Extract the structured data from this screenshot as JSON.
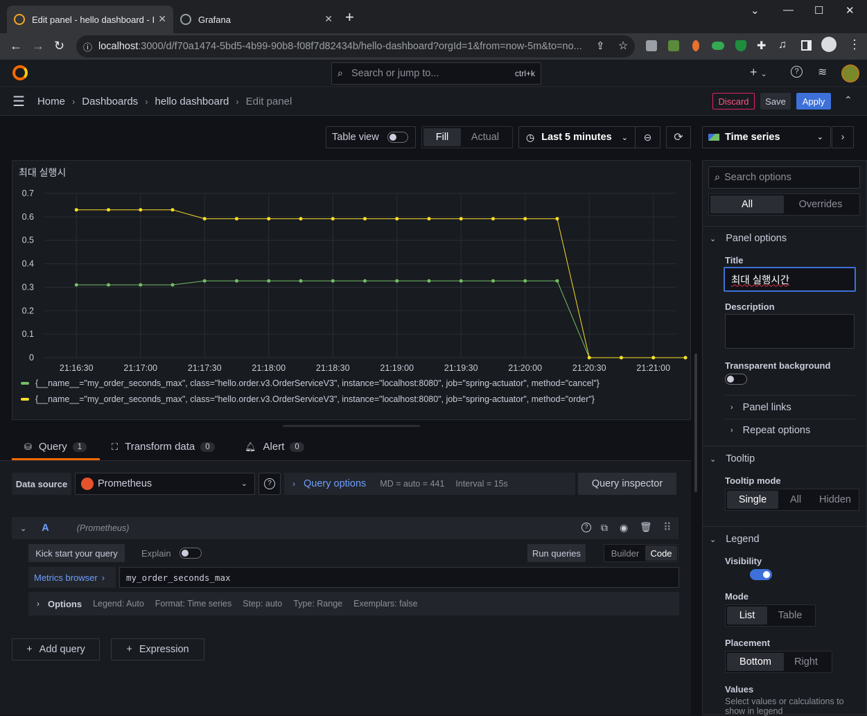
{
  "browser": {
    "tabs": [
      {
        "title": "Edit panel - hello dashboard - I"
      },
      {
        "title": "Grafana"
      }
    ],
    "url_host": "localhost",
    "url_path": ":3000/d/f70a1474-5bd5-4b99-90b8-f08f7d82434b/hello-dashboard?orgId=1&from=now-5m&to=no..."
  },
  "header": {
    "search_placeholder": "Search or jump to...",
    "search_shortcut": "ctrl+k",
    "add_label": "+"
  },
  "breadcrumbs": [
    "Home",
    "Dashboards",
    "hello dashboard",
    "Edit panel"
  ],
  "actions": {
    "discard": "Discard",
    "save": "Save",
    "apply": "Apply"
  },
  "panel_toolbar": {
    "table_view": "Table view",
    "fill": "Fill",
    "actual": "Actual",
    "time_range": "Last 5 minutes",
    "viz_type": "Time series"
  },
  "panel": {
    "title": "최대 실행시"
  },
  "chart_data": {
    "type": "line",
    "title": "최대 실행시",
    "x_ticks": [
      "21:16:30",
      "21:17:00",
      "21:17:30",
      "21:18:00",
      "21:18:30",
      "21:19:00",
      "21:19:30",
      "21:20:00",
      "21:20:30",
      "21:21:00"
    ],
    "y_ticks": [
      "0",
      "0.1",
      "0.2",
      "0.3",
      "0.4",
      "0.5",
      "0.6",
      "0.7"
    ],
    "ylim": [
      0,
      0.7
    ],
    "x": [
      "21:16:30",
      "21:16:45",
      "21:17:00",
      "21:17:15",
      "21:17:30",
      "21:17:45",
      "21:18:00",
      "21:18:15",
      "21:18:30",
      "21:18:45",
      "21:19:00",
      "21:19:15",
      "21:19:30",
      "21:19:45",
      "21:20:00",
      "21:20:15",
      "21:20:30",
      "21:20:45",
      "21:21:00",
      "21:21:15"
    ],
    "series": [
      {
        "name": "{__name__=\"my_order_seconds_max\", class=\"hello.order.v3.OrderServiceV3\", instance=\"localhost:8080\", job=\"spring-actuator\", method=\"cancel\"}",
        "color": "#73bf69",
        "values": [
          0.31,
          0.31,
          0.31,
          0.31,
          0.327,
          0.327,
          0.327,
          0.327,
          0.327,
          0.327,
          0.327,
          0.327,
          0.327,
          0.327,
          0.327,
          0.327,
          0,
          0,
          0,
          0
        ]
      },
      {
        "name": "{__name__=\"my_order_seconds_max\", class=\"hello.order.v3.OrderServiceV3\", instance=\"localhost:8080\", job=\"spring-actuator\", method=\"order\"}",
        "color": "#fade2a",
        "values": [
          0.63,
          0.63,
          0.63,
          0.63,
          0.592,
          0.592,
          0.592,
          0.592,
          0.592,
          0.592,
          0.592,
          0.592,
          0.592,
          0.592,
          0.592,
          0.592,
          0,
          0,
          0,
          0
        ]
      }
    ],
    "grid": true,
    "legend": "bottom"
  },
  "query_tabs": [
    {
      "label": "Query",
      "count": "1"
    },
    {
      "label": "Transform data",
      "count": "0"
    },
    {
      "label": "Alert",
      "count": "0"
    }
  ],
  "query": {
    "data_source_label": "Data source",
    "data_source": "Prometheus",
    "query_options": "Query options",
    "md": "MD = auto = 441",
    "interval": "Interval = 15s",
    "inspector": "Query inspector",
    "ref_id": "A",
    "ref_ds": "(Prometheus)",
    "kick_start": "Kick start your query",
    "explain": "Explain",
    "run_queries": "Run queries",
    "builder": "Builder",
    "code": "Code",
    "metrics_browser": "Metrics browser",
    "expr": "my_order_seconds_max",
    "options_label": "Options",
    "options": [
      "Legend: Auto",
      "Format: Time series",
      "Step: auto",
      "Type: Range",
      "Exemplars: false"
    ],
    "add_query": "Add query",
    "expression": "Expression"
  },
  "options_pane": {
    "search_placeholder": "Search options",
    "all": "All",
    "overrides": "Overrides",
    "panel_options": "Panel options",
    "title_label": "Title",
    "title_value": "최대 실행시간",
    "description_label": "Description",
    "transparent_label": "Transparent background",
    "panel_links": "Panel links",
    "repeat_options": "Repeat options",
    "tooltip": "Tooltip",
    "tooltip_mode_label": "Tooltip mode",
    "tooltip_modes": [
      "Single",
      "All",
      "Hidden"
    ],
    "legend": "Legend",
    "visibility_label": "Visibility",
    "mode_label": "Mode",
    "modes": [
      "List",
      "Table"
    ],
    "placement_label": "Placement",
    "placements": [
      "Bottom",
      "Right"
    ],
    "values_label": "Values",
    "values_desc": "Select values or calculations to show in legend"
  }
}
